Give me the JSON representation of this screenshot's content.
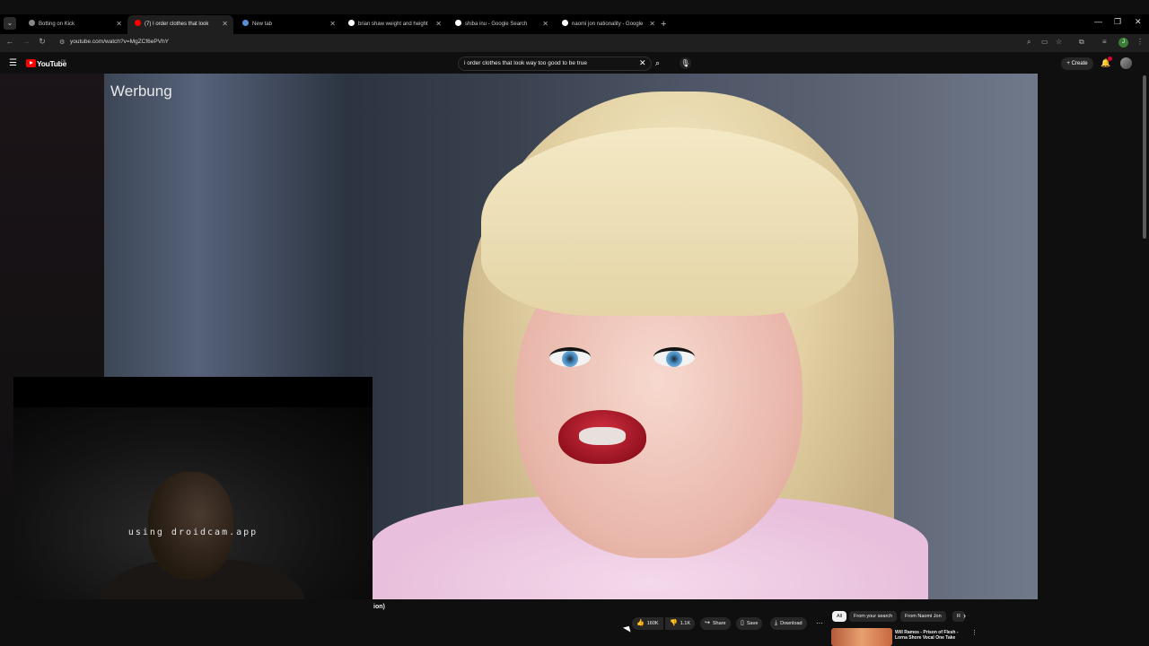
{
  "browser": {
    "tabs": [
      {
        "title": "Botting on Kick",
        "favicon": "globe-icon"
      },
      {
        "title": "(7) I order clothes that look",
        "favicon": "youtube-icon",
        "active": true
      },
      {
        "title": "New tab",
        "favicon": "chrome-icon"
      },
      {
        "title": "brian shaw weight and height",
        "favicon": "google-icon"
      },
      {
        "title": "shiba inu - Google Search",
        "favicon": "google-icon"
      },
      {
        "title": "naomi jon nationality - Google",
        "favicon": "google-icon"
      }
    ],
    "new_tab_label": "+",
    "url": "youtube.com/watch?v=MgZCf6ePVhY",
    "window_controls": [
      "—",
      "❐",
      "✕"
    ]
  },
  "youtube": {
    "logo_text": "YouTube",
    "country_code": "DE",
    "search_query": "i order clothes that look way too good to be true",
    "create_label": "Create"
  },
  "video": {
    "ad_label": "Werbung",
    "title_fragment": "ion)"
  },
  "webcam": {
    "watermark": "using droidcam.app"
  },
  "actions": {
    "likes": "160K",
    "dislikes": "1.1K",
    "share": "Share",
    "save": "Save",
    "download": "Download"
  },
  "chips": [
    "All",
    "From your search",
    "From Naomi Jon",
    "R"
  ],
  "recommendation": {
    "title": "Will Ramos - Prison of Flesh - Lorna Shore Vocal One Take"
  },
  "colors": {
    "youtube_red": "#ff0000",
    "background": "#0f0f0f",
    "pill_bg": "#272727"
  }
}
